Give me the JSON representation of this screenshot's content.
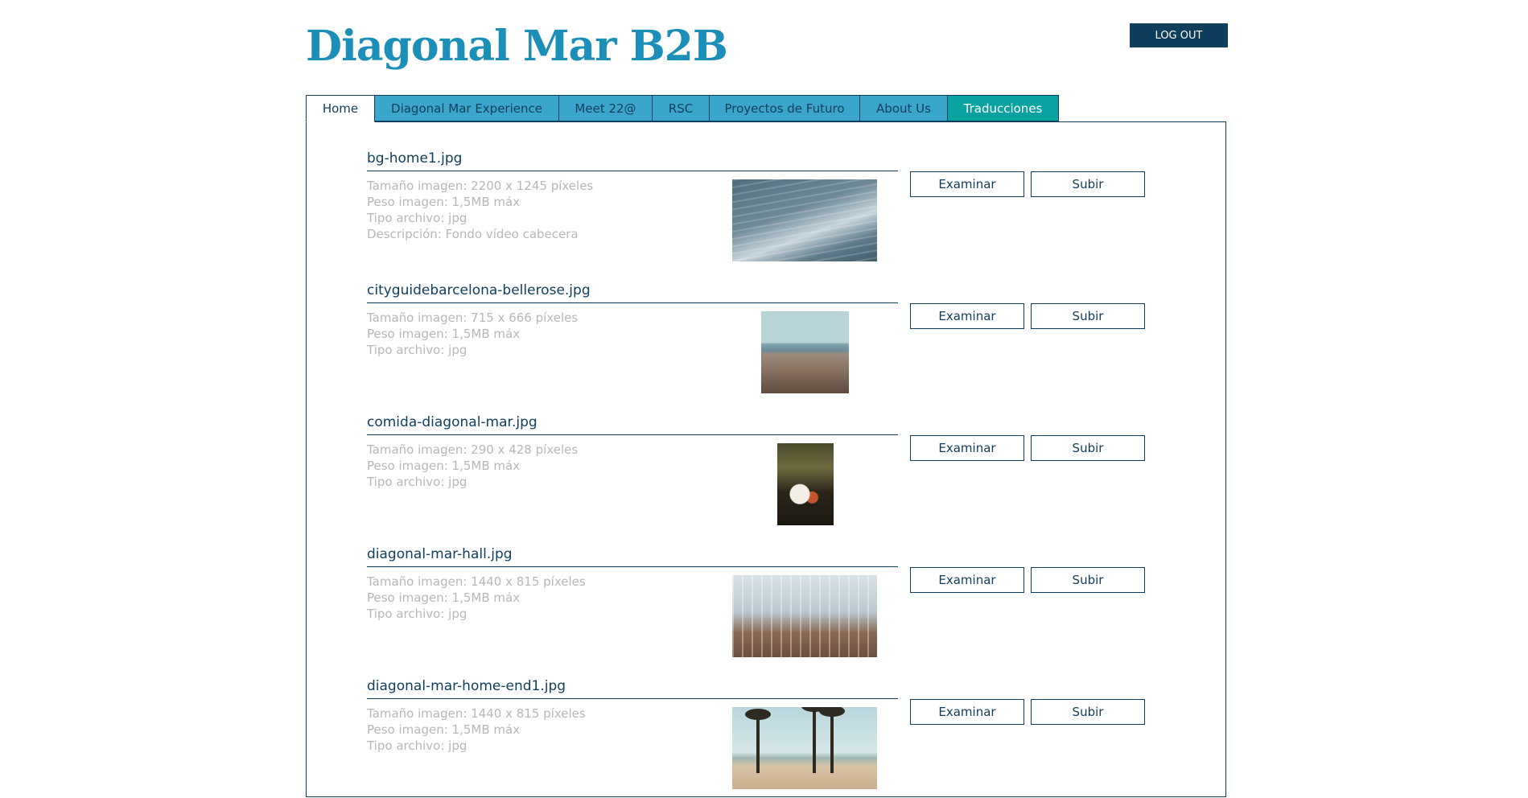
{
  "header": {
    "brand": "Diagonal Mar B2B",
    "logout_label": "LOG OUT"
  },
  "tabs": [
    {
      "label": "Home",
      "active": true
    },
    {
      "label": "Diagonal Mar Experience"
    },
    {
      "label": "Meet 22@"
    },
    {
      "label": "RSC"
    },
    {
      "label": "Proyectos de Futuro"
    },
    {
      "label": "About Us"
    },
    {
      "label": "Traducciones",
      "accent": "#0aa2a0"
    }
  ],
  "buttons": {
    "browse_label": "Examinar",
    "upload_label": "Subir"
  },
  "files": [
    {
      "name": "bg-home1.jpg",
      "size": "Tamaño imagen: 2200 x 1245 píxeles",
      "weight": "Peso imagen: 1,5MB máx",
      "type": "Tipo archivo: jpg",
      "description": "Descripción: Fondo vídeo cabecera",
      "thumb_icon": "sea-thumbnail"
    },
    {
      "name": "cityguidebarcelona-bellerose.jpg",
      "size": "Tamaño imagen: 715 x 666 píxeles",
      "weight": "Peso imagen: 1,5MB máx",
      "type": "Tipo archivo: jpg",
      "thumb_icon": "city-thumbnail"
    },
    {
      "name": "comida-diagonal-mar.jpg",
      "size": "Tamaño imagen: 290 x 428 píxeles",
      "weight": "Peso imagen: 1,5MB máx",
      "type": "Tipo archivo: jpg",
      "thumb_icon": "food-thumbnail"
    },
    {
      "name": "diagonal-mar-hall.jpg",
      "size": "Tamaño imagen: 1440 x 815 píxeles",
      "weight": "Peso imagen: 1,5MB máx",
      "type": "Tipo archivo: jpg",
      "thumb_icon": "hall-thumbnail"
    },
    {
      "name": "diagonal-mar-home-end1.jpg",
      "size": "Tamaño imagen: 1440 x 815 píxeles",
      "weight": "Peso imagen: 1,5MB máx",
      "type": "Tipo archivo: jpg",
      "thumb_icon": "beach-thumbnail"
    }
  ],
  "colors": {
    "brand": "#1b8fb8",
    "navy": "#0f3d5c",
    "tab": "#3aa6cc",
    "tab_accent": "#0aa2a0",
    "meta_text": "#b4b8bc"
  }
}
